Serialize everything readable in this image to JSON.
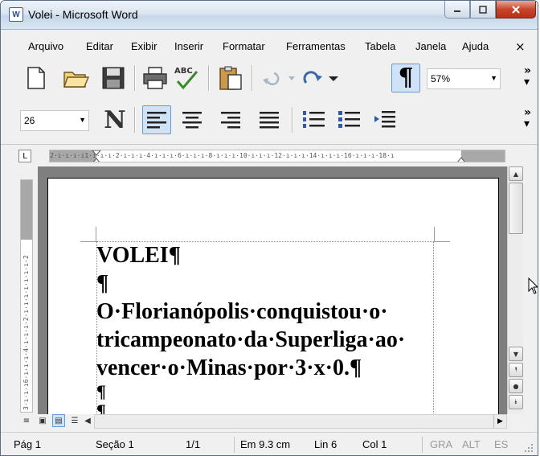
{
  "window": {
    "title": "Volei - Microsoft Word",
    "app_icon": "W"
  },
  "menu": {
    "items": [
      "Arquivo",
      "Editar",
      "Exibir",
      "Inserir",
      "Formatar",
      "Ferramentas",
      "Tabela",
      "Janela",
      "Ajuda"
    ],
    "close_glyph": "×"
  },
  "toolbar1": {
    "zoom_value": "57%"
  },
  "toolbar2": {
    "font_size_value": "26",
    "bold_label": "N"
  },
  "ruler": {
    "tab_selector": "L",
    "horizontal_marks": "2·ı·ı·ı·ı1·ı·ı·ı·2·ı·ı·ı·4·ı·ı·ı·6·ı·ı·ı·8·ı·ı·ı·10·ı·ı·ı·12·ı·ı·ı·14·ı·ı·ı·16·ı·ı·ı·18·ı",
    "vertical_marks": "3·ı·ı·ı6·ı·ı·ı·4·ı·ı·ı·2·ı·ı·ı·ı·ı·ı·ı·2"
  },
  "document": {
    "lines": [
      "VOLEI¶",
      "¶",
      "O·Florianópolis·conquistou·o·",
      "tricampeonato·da·Superliga·ao·",
      "vencer·o·Minas·por·3·x·0.¶",
      "¶",
      "¶"
    ]
  },
  "statusbar": {
    "page": "Pág 1",
    "section": "Seção 1",
    "page_count": "1/1",
    "position": "Em 9.3 cm",
    "line": "Lin 6",
    "column": "Col 1",
    "rec": "GRA",
    "ext": "ALT",
    "ovr": "ES"
  },
  "colors": {
    "accent": "#6a9ad4",
    "close_button": "#c8452c",
    "doc_background": "#7f7f7f"
  }
}
